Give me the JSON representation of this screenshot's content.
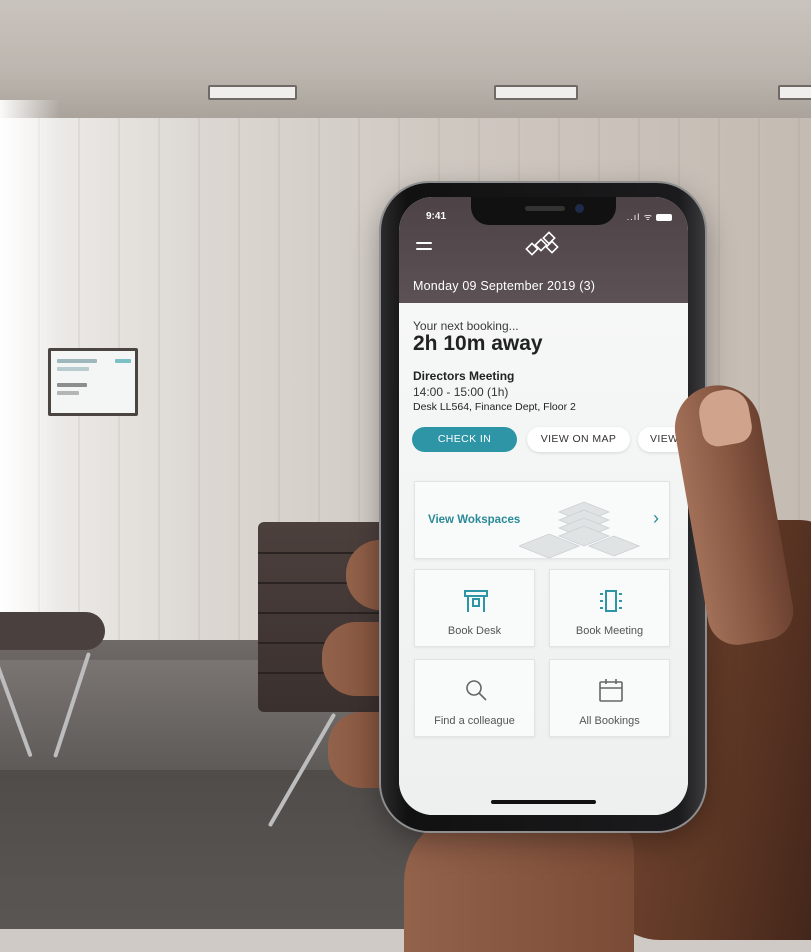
{
  "status_bar": {
    "time": "9:41",
    "signal": "..ıl ᯤ"
  },
  "header": {
    "date": "Monday 09 September 2019 (3)"
  },
  "next_booking": {
    "label": "Your next booking...",
    "countdown": "2h 10m away",
    "title": "Directors Meeting",
    "time": "14:00 - 15:00 (1h)",
    "location": "Desk LL564, Finance Dept, Floor 2"
  },
  "actions": {
    "check_in": "CHECK IN",
    "view_on_map": "VIEW ON MAP",
    "view_more": "VIEW I"
  },
  "workspaces": {
    "label": "View Wokspaces",
    "chevron": "›"
  },
  "tiles": [
    {
      "label": "Book Desk",
      "icon": "desk-icon"
    },
    {
      "label": "Book Meeting",
      "icon": "meeting-room-icon"
    },
    {
      "label": "Find a colleague",
      "icon": "search-icon"
    },
    {
      "label": "All Bookings",
      "icon": "calendar-icon"
    }
  ],
  "colors": {
    "header": "#4d4346",
    "accent": "#2d95a6",
    "link": "#2a8a98",
    "background": "#eef0f0"
  }
}
